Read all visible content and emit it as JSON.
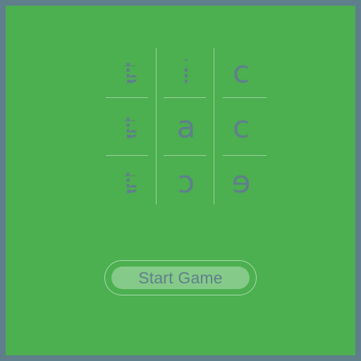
{
  "board": {
    "cells": [
      {
        "glyph": "ȶ",
        "icon": "rotated-t-glyph"
      },
      {
        "glyph": "i",
        "icon": "dashed-i-glyph"
      },
      {
        "glyph": "c",
        "icon": "c-arrow-glyph"
      },
      {
        "glyph": "ȶ",
        "icon": "rotated-t-glyph"
      },
      {
        "glyph": "a",
        "icon": "a-arrow-glyph"
      },
      {
        "glyph": "c",
        "icon": "c-arrow-glyph"
      },
      {
        "glyph": "ȶ",
        "icon": "rotated-t-glyph"
      },
      {
        "glyph": "ɔ",
        "icon": "o-arrow-glyph"
      },
      {
        "glyph": "ɘ",
        "icon": "e-arrow-glyph"
      }
    ]
  },
  "start_button": {
    "label": "Start Game"
  },
  "colors": {
    "background": "#4caf50",
    "border": "#5f7f8c",
    "glyph": "#5f7f8c"
  }
}
